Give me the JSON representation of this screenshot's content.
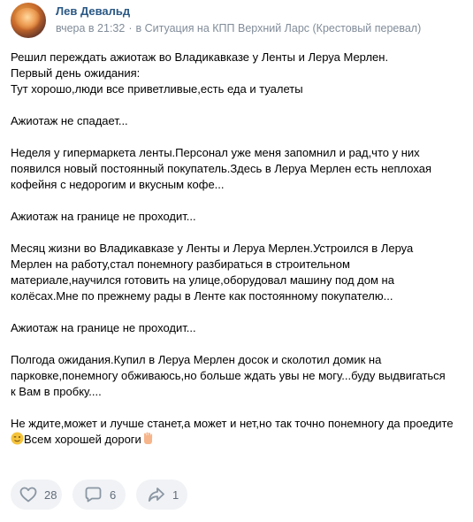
{
  "post": {
    "author": "Лев Девальд",
    "time": "вчера в 21:32",
    "separator": "·",
    "community": "в Ситуация на КПП Верхний Ларс (Крестовый перевал)",
    "more_label": "···",
    "text": "Решил переждать ажиотаж во Владикавказе у Ленты и Леруа Мерлен.\nПервый день ожидания:\nТут хорошо,люди все приветливые,есть еда и туалеты\n\nАжиотаж не спадает...\n\nНеделя у гипермаркета ленты.Персонал уже меня запомнил и рад,что у них\nпоявился новый постоянный покупатель.Здесь в Леруа Мерлен есть неплохая\nкофейня с недорогим и вкусным кофе...\n\nАжиотаж на границе не проходит...\n\nМесяц жизни во Владикавказе у Ленты и Леруа Мерлен.Устроился в Леруа\nМерлен на работу,стал понемногу разбираться в строительном\nматериале,научился готовить на улице,оборудовал машину под дом на\nколёсах.Мне по прежнему рады в Ленте как постоянному покупателю...\n\nАжиотаж на границе не проходит...\n\nПолгода ожидания.Купил в Леруа Мерлен досок и сколотил домик на\nпарковке,понемногу обживаюсь,но больше ждать увы не могу...буду выдвигаться\nк Вам в пробку....\n\nНе ждите,может и лучше станет,а может и нет,но так точно понемногу да проедите",
    "last_line": "Всем хорошей дороги"
  },
  "actions": {
    "likes": "28",
    "comments": "6",
    "shares": "1"
  },
  "colors": {
    "link": "#2a5885",
    "meta": "#818c99",
    "pill_bg": "#f0f2f5",
    "icon": "#8a96a3"
  }
}
